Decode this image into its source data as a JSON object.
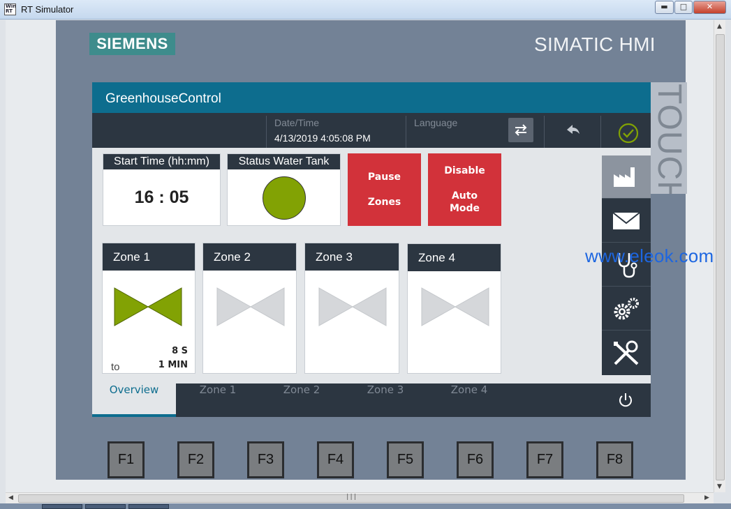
{
  "window": {
    "title": "RT Simulator",
    "app_icon_text": "WinCC RT",
    "minimize_glyph": "▬",
    "maximize_glyph": "□",
    "close_glyph": "✕"
  },
  "device": {
    "brand": "SIEMENS",
    "product": "SIMATIC HMI",
    "side_label": "TOUCH"
  },
  "watermark": "www.eleok.com",
  "screen": {
    "title": "GreenhouseControl",
    "datetime_label": "Date/Time",
    "datetime_value": "4/13/2019 4:05:08 PM",
    "language_label": "Language"
  },
  "start_time": {
    "title": "Start Time (hh:mm)",
    "value": "16 : 05"
  },
  "water_tank": {
    "title": "Status Water Tank",
    "light_color": "#82a204"
  },
  "buttons": {
    "pause_line1": "Pause",
    "pause_line2": "Zones",
    "disable_line1": "Disable",
    "disable_line2": "Auto",
    "disable_line3": "Mode"
  },
  "zones": [
    {
      "name": "Zone 1",
      "active": true,
      "duration": "8 S",
      "to_label": "to",
      "interval": "1 MIN"
    },
    {
      "name": "Zone 2",
      "active": false
    },
    {
      "name": "Zone 3",
      "active": false
    },
    {
      "name": "Zone 4",
      "active": false
    }
  ],
  "side_nav": [
    "factory-icon",
    "envelope-icon",
    "stethoscope-icon",
    "gears-icon",
    "tools-icon"
  ],
  "tabs": [
    "Overview",
    "Zone 1",
    "Zone 2",
    "Zone 3",
    "Zone 4"
  ],
  "active_tab": "Overview",
  "function_keys": [
    "F1",
    "F2",
    "F3",
    "F4",
    "F5",
    "F6",
    "F7",
    "F8"
  ],
  "colors": {
    "header_blue": "#0d6d8e",
    "dark_panel": "#2c3641",
    "alarm_red": "#d2323a",
    "valve_open": "#82a204",
    "valve_closed": "#d5d7da"
  }
}
